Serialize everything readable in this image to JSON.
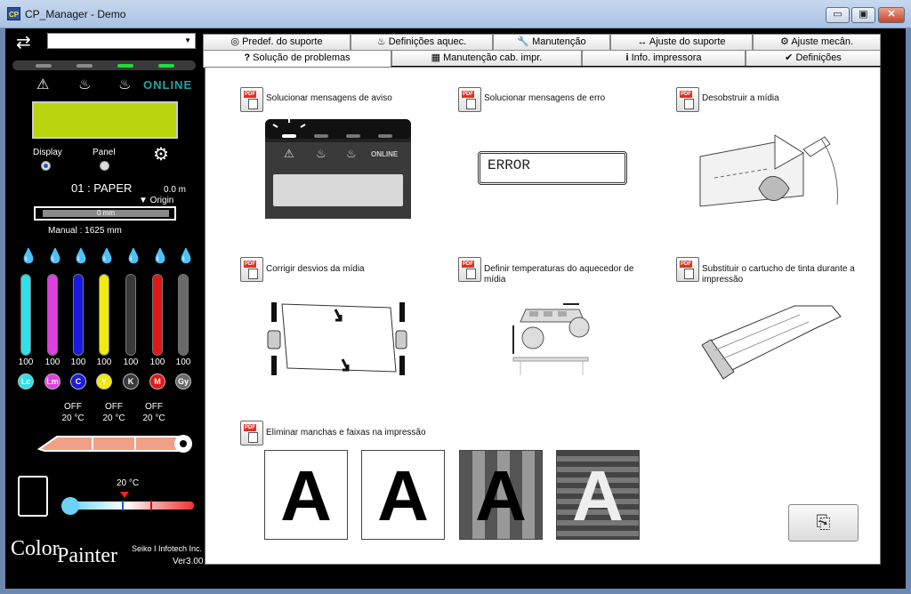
{
  "window": {
    "title": "CP_Manager - Demo",
    "app_icon_text": "CP",
    "minimize": "▭",
    "maximize": "▣",
    "close": "✕"
  },
  "left_panel": {
    "sync_icon": "⇄",
    "printer_combo_value": "",
    "leds": [
      "off",
      "off",
      "on",
      "on"
    ],
    "status_icons": [
      "warning-icon",
      "heater-icon",
      "ink-tank-icon"
    ],
    "status_glyphs": [
      "⚠",
      "♨",
      "♨"
    ],
    "online_label": "ONLINE",
    "lcd_color": "#b9d50e",
    "display_label": "Display",
    "panel_label": "Panel",
    "settings_glyph": "⚙",
    "media_name": "01 : PAPER",
    "media_position": "0.0  m",
    "origin_label": "▼ Origin",
    "media_bar_value": "0  mm",
    "manual_length": "Manual : 1625  mm",
    "inks": [
      {
        "code": "Lc",
        "value": "100",
        "color": "#2fe0e8",
        "level": 1.0
      },
      {
        "code": "Lm",
        "value": "100",
        "color": "#e13fe1",
        "level": 1.0
      },
      {
        "code": "C",
        "value": "100",
        "color": "#1a1ae0",
        "level": 1.0
      },
      {
        "code": "Y",
        "value": "100",
        "color": "#f0ea10",
        "level": 1.0
      },
      {
        "code": "K",
        "value": "100",
        "color": "#3a3a3a",
        "level": 1.0
      },
      {
        "code": "M",
        "value": "100",
        "color": "#e01818",
        "level": 1.0
      },
      {
        "code": "Gy",
        "value": "100",
        "color": "#6a6a6a",
        "level": 1.0
      }
    ],
    "heaters": [
      {
        "state": "OFF",
        "temp": "20 °C"
      },
      {
        "state": "OFF",
        "temp": "20 °C"
      },
      {
        "state": "OFF",
        "temp": "20 °C"
      }
    ],
    "ambient_temp": "20 °C",
    "logo_color": "Color",
    "logo_painter": "Painter",
    "maker": "Seiko I Infotech Inc.",
    "version": "Ver3.00"
  },
  "tabs_row1": [
    {
      "label": "Predef. do suporte",
      "glyph": "◎"
    },
    {
      "label": "Definições aquec.",
      "glyph": "♨"
    },
    {
      "label": "Manutenção",
      "glyph": "🔧"
    },
    {
      "label": "Ajuste do suporte",
      "glyph": "↔"
    },
    {
      "label": "Ajuste mecân.",
      "glyph": "⚙"
    }
  ],
  "tabs_row2": [
    {
      "label": "Solução de problemas",
      "glyph": "?"
    },
    {
      "label": "Manutenção cab. impr.",
      "glyph": "▦"
    },
    {
      "label": "Info. impressora",
      "glyph": "i"
    },
    {
      "label": "Definições",
      "glyph": "✔"
    }
  ],
  "pdf_badge": "PDF",
  "items": [
    {
      "label": "Solucionar mensagens de aviso"
    },
    {
      "label": "Solucionar mensagens de erro"
    },
    {
      "label": "Desobstruir a mídia"
    },
    {
      "label": "Corrigir desvios da mídia"
    },
    {
      "label": "Definir temperaturas do aquecedor de mídia"
    },
    {
      "label": "Substituir o cartucho de tinta durante a impressão"
    },
    {
      "label": "Eliminar manchas e faixas na impressão"
    }
  ],
  "error_text": "ERROR",
  "panel_online": "ONLINE",
  "sample_letter": "A",
  "copy_glyph": "⎘"
}
